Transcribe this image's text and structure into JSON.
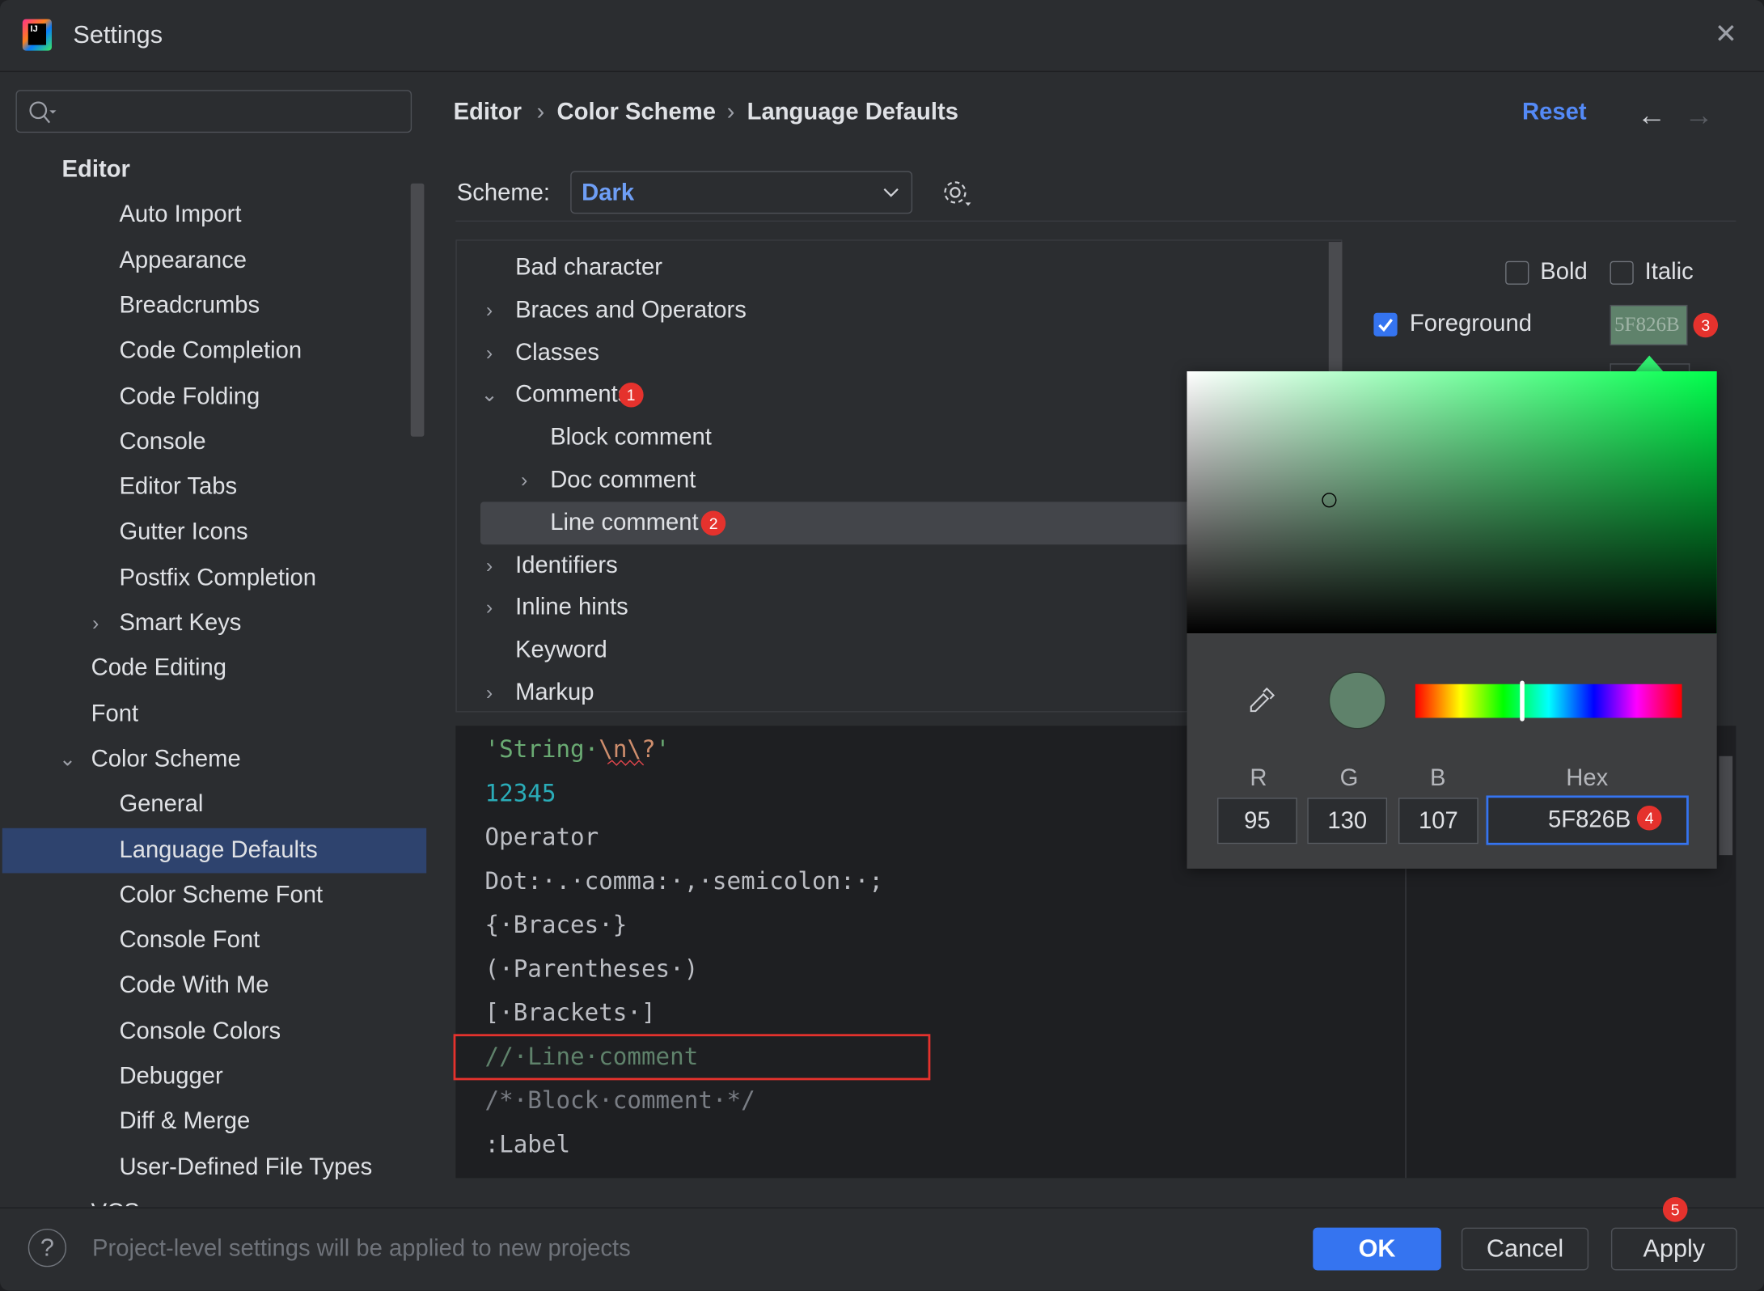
{
  "window": {
    "title": "Settings",
    "logo_text": "IJ"
  },
  "search": {
    "placeholder": ""
  },
  "sidebar": {
    "items": [
      {
        "label": "Editor",
        "level": 0,
        "bold": true
      },
      {
        "label": "Auto Import",
        "level": 2
      },
      {
        "label": "Appearance",
        "level": 2
      },
      {
        "label": "Breadcrumbs",
        "level": 2
      },
      {
        "label": "Code Completion",
        "level": 2
      },
      {
        "label": "Code Folding",
        "level": 2
      },
      {
        "label": "Console",
        "level": 2
      },
      {
        "label": "Editor Tabs",
        "level": 2
      },
      {
        "label": "Gutter Icons",
        "level": 2
      },
      {
        "label": "Postfix Completion",
        "level": 2
      },
      {
        "label": "Smart Keys",
        "level": 2,
        "expander": "collapsed"
      },
      {
        "label": "Code Editing",
        "level": 1
      },
      {
        "label": "Font",
        "level": 1
      },
      {
        "label": "Color Scheme",
        "level": 1,
        "expander": "expanded"
      },
      {
        "label": "General",
        "level": 2
      },
      {
        "label": "Language Defaults",
        "level": 2,
        "selected": true
      },
      {
        "label": "Color Scheme Font",
        "level": 2
      },
      {
        "label": "Console Font",
        "level": 2
      },
      {
        "label": "Code With Me",
        "level": 2
      },
      {
        "label": "Console Colors",
        "level": 2
      },
      {
        "label": "Debugger",
        "level": 2
      },
      {
        "label": "Diff & Merge",
        "level": 2
      },
      {
        "label": "User-Defined File Types",
        "level": 2
      },
      {
        "label": "VCS",
        "level": 1
      }
    ]
  },
  "breadcrumb": {
    "items": [
      "Editor",
      "Color Scheme",
      "Language Defaults"
    ],
    "separator": "›"
  },
  "header": {
    "reset_label": "Reset",
    "back_icon": "arrow-left-icon",
    "forward_icon": "arrow-right-icon"
  },
  "scheme": {
    "label": "Scheme:",
    "value": "Dark"
  },
  "tree": {
    "items": [
      {
        "label": "Bad character",
        "level": 0
      },
      {
        "label": "Braces and Operators",
        "level": 0,
        "expander": "collapsed"
      },
      {
        "label": "Classes",
        "level": 0,
        "expander": "collapsed"
      },
      {
        "label": "Comments",
        "level": 0,
        "expander": "expanded",
        "badge": "1"
      },
      {
        "label": "Block comment",
        "level": 1
      },
      {
        "label": "Doc comment",
        "level": 1,
        "expander": "collapsed"
      },
      {
        "label": "Line comment",
        "level": 1,
        "selected": true,
        "badge": "2"
      },
      {
        "label": "Identifiers",
        "level": 0,
        "expander": "collapsed"
      },
      {
        "label": "Inline hints",
        "level": 0,
        "expander": "collapsed"
      },
      {
        "label": "Keyword",
        "level": 0
      },
      {
        "label": "Markup",
        "level": 0,
        "expander": "collapsed"
      }
    ]
  },
  "attributes": {
    "bold": {
      "label": "Bold",
      "checked": false
    },
    "italic": {
      "label": "Italic",
      "checked": false
    },
    "foreground": {
      "label": "Foreground",
      "checked": true,
      "value": "5F826B",
      "badge": "3"
    }
  },
  "color_picker": {
    "labels": {
      "r": "R",
      "g": "G",
      "b": "B",
      "hex": "Hex"
    },
    "r": "95",
    "g": "130",
    "b": "107",
    "hex": "5F826B",
    "hex_badge": "4",
    "hue_fraction": 0.4,
    "color": "#5F826B"
  },
  "preview": {
    "lines": [
      [
        {
          "text": "'String·",
          "color": "#6aab73"
        },
        {
          "text": "\\n\\?",
          "color": "#cf8e6d"
        },
        {
          "text": "'",
          "color": "#6aab73"
        }
      ],
      [
        {
          "text": "12345",
          "color": "#2aacb8"
        }
      ],
      [
        {
          "text": "Operator",
          "color": "#bcbec4"
        }
      ],
      [
        {
          "text": "Dot:·.·comma:·,·semicolon:·;",
          "color": "#bcbec4"
        }
      ],
      [
        {
          "text": "{·Braces·}",
          "color": "#bcbec4"
        }
      ],
      [
        {
          "text": "(·Parentheses·)",
          "color": "#bcbec4"
        }
      ],
      [
        {
          "text": "[·Brackets·]",
          "color": "#bcbec4"
        }
      ],
      [
        {
          "text": "//·Line·comment",
          "color": "#5f826b"
        }
      ],
      [
        {
          "text": "/*·Block·comment·*/",
          "color": "#7a7e85"
        }
      ],
      [
        {
          "text": ":Label",
          "color": "#bcbec4"
        }
      ]
    ],
    "highlighted_line": 7
  },
  "footer": {
    "help_icon": "help-icon",
    "message": "Project-level settings will be applied to new projects",
    "ok_label": "OK",
    "cancel_label": "Cancel",
    "apply_label": "Apply",
    "apply_badge": "5"
  },
  "colors": {
    "accent": "#3574f0",
    "link": "#548af7",
    "badge": "#e5322d",
    "selection": "#2e436e"
  }
}
